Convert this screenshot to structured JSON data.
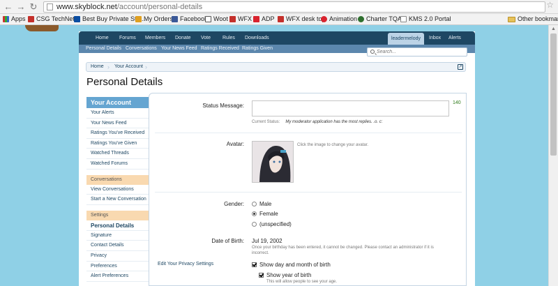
{
  "browser": {
    "url_host": "www.skyblock.net",
    "url_path": "/account/personal-details",
    "bookmarks": [
      {
        "label": "Apps",
        "color": "#4a86c5"
      },
      {
        "label": "CSG TechNet®",
        "color": "#c4302b"
      },
      {
        "label": "Best Buy Private Sto...",
        "color": "#0b4ea2"
      },
      {
        "label": "My Orders",
        "color": "#e0a020"
      },
      {
        "label": "Facebook",
        "color": "#3b5998"
      },
      {
        "label": "Woot",
        "color": "#555555"
      },
      {
        "label": "WFX",
        "color": "#c4302b"
      },
      {
        "label": "ADP",
        "color": "#d9232e"
      },
      {
        "label": "WFX desk top",
        "color": "#c4302b"
      },
      {
        "label": "Animation",
        "color": "#d9232e"
      },
      {
        "label": "Charter TQA",
        "color": "#2f6f2f"
      },
      {
        "label": "KMS 2.0 Portal",
        "color": "#888888"
      }
    ],
    "other_bookmarks": "Other bookmarks"
  },
  "nav": {
    "items": [
      "Home",
      "Forums",
      "Members",
      "Donate",
      "Vote",
      "Rules",
      "Downloads"
    ],
    "user": "leadermelody",
    "inbox": "Inbox",
    "alerts": "Alerts"
  },
  "subnav": {
    "items": [
      "Personal Details",
      "Conversations",
      "Your News Feed",
      "Ratings Received",
      "Ratings Given"
    ]
  },
  "search": {
    "placeholder": "Search..."
  },
  "breadcrumb": {
    "home": "Home",
    "current": "Your Account"
  },
  "page_title": "Personal Details",
  "sidebar": {
    "header": "Your Account",
    "links1": [
      "Your Alerts",
      "Your News Feed",
      "Ratings You've Received",
      "Ratings You've Given",
      "Watched Threads",
      "Watched Forums"
    ],
    "section_conversations": "Conversations",
    "links2": [
      "View Conversations",
      "Start a New Conversation"
    ],
    "section_settings": "Settings",
    "active": "Personal Details",
    "links3": [
      "Signature",
      "Contact Details",
      "Privacy",
      "Preferences",
      "Alert Preferences"
    ]
  },
  "form": {
    "status_label": "Status Message:",
    "status_value": "",
    "counter": "140",
    "current_status_label": "Current Status:",
    "current_status_text": "My moderator application has the most replies. .o. c:",
    "avatar_label": "Avatar:",
    "avatar_hint": "Click the image to change your avatar.",
    "gender_label": "Gender:",
    "gender_options": [
      "Male",
      "Female",
      "(unspecified)"
    ],
    "gender_selected": "Female",
    "dob_label": "Date of Birth:",
    "dob_value": "Jul 19, 2002",
    "dob_hint_1": "Once your birthday has been entered, it cannot be changed. Please contact an administrator if it is",
    "dob_hint_2": "incorrect.",
    "privacy_link": "Edit Your Privacy Settings",
    "show_day_month": "Show day and month of birth",
    "show_year": "Show year of birth",
    "show_year_hint": "This will allow people to see your age."
  }
}
